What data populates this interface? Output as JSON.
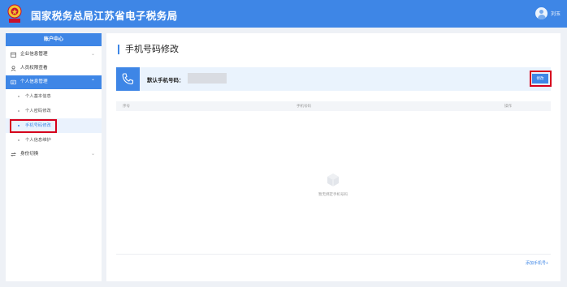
{
  "header": {
    "site_title": "国家税务总局江苏省电子税务局",
    "user_name": "刘玉"
  },
  "sidebar": {
    "title": "账户中心",
    "items": [
      {
        "label": "企业信息管理",
        "icon": "building-icon",
        "expanded": false
      },
      {
        "label": "人员权限查看",
        "icon": "people-icon"
      },
      {
        "label": "个人信息管理",
        "icon": "id-card-icon",
        "expanded": true,
        "active": true
      },
      {
        "label": "身份切换",
        "icon": "switch-icon",
        "expanded": false
      }
    ],
    "sub_items": [
      {
        "label": "个人基本信息"
      },
      {
        "label": "个人密码修改"
      },
      {
        "label": "手机号码修改",
        "current": true
      },
      {
        "label": "个人信息维护"
      }
    ]
  },
  "main": {
    "page_title": "手机号码修改",
    "default_phone_label": "默认手机号码：",
    "modify_label": "修改",
    "table_columns": [
      "序号",
      "手机号码",
      "操作"
    ],
    "empty_text": "暂无绑定手机号码",
    "add_link": "添加手机号+"
  },
  "colors": {
    "brand_blue": "#3e86e6",
    "highlight_red": "#d6001c"
  }
}
